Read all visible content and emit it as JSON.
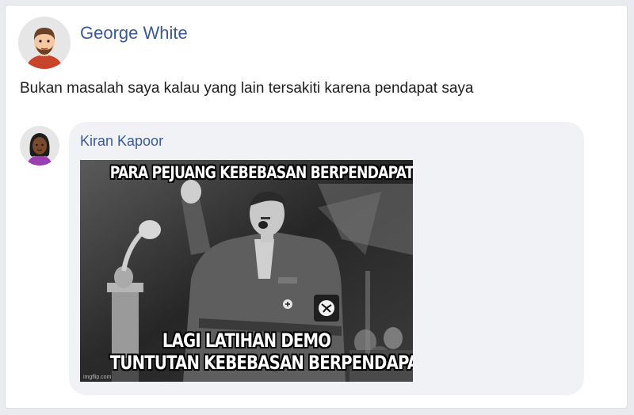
{
  "post": {
    "author_name": "George White",
    "text": "Bukan masalah saya kalau yang lain tersakiti karena pendapat saya"
  },
  "comment": {
    "author_name": "Kiran Kapoor",
    "meme": {
      "top_text": "PARA PEJUANG KEBEBASAN BERPENDAPAT",
      "bottom_text_line1": "LAGI LATIHAN DEMO",
      "bottom_text_line2": "TUNTUTAN KEBEBASAN BERPENDAPAT",
      "watermark": "imgflip.com"
    }
  },
  "colors": {
    "name_link": "#3b5998",
    "bubble_bg": "#f0f2f5",
    "page_bg": "#e9ebee"
  }
}
